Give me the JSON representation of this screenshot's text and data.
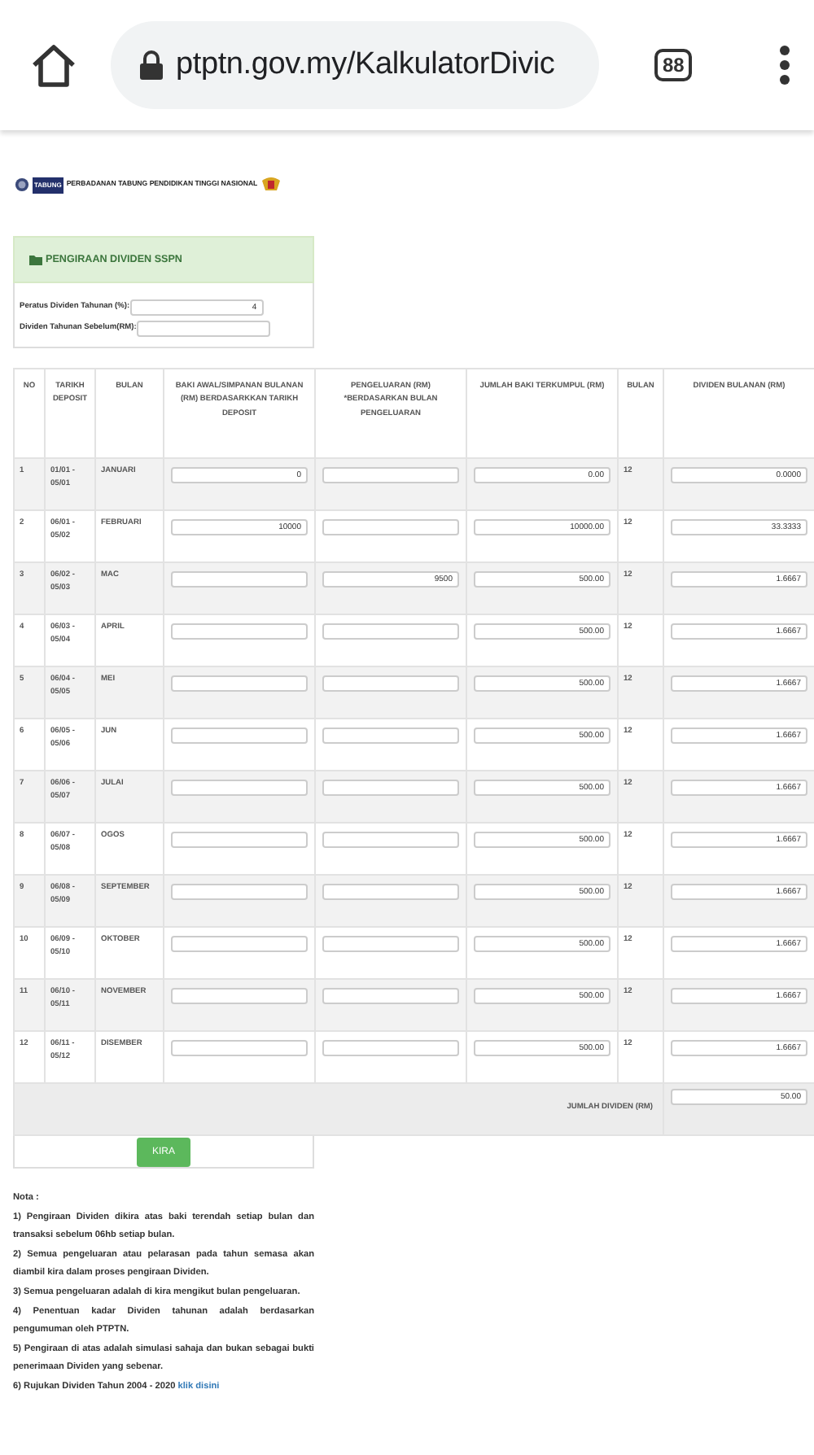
{
  "browser": {
    "url": "ptptn.gov.my/KalkulatorDivic",
    "tab_count": "88"
  },
  "header": {
    "logo_text": "TABUNG",
    "org_name": "PERBADANAN TABUNG PENDIDIKAN TINGGI NASIONAL"
  },
  "panel": {
    "title": "PENGIRAAN DIVIDEN SSPN",
    "fields": [
      {
        "label": "Peratus Dividen Tahunan (%):",
        "value": "4"
      },
      {
        "label": "Dividen Tahunan Sebelum(RM):"
      }
    ]
  },
  "table": {
    "columns": [
      "NO",
      "TARIKH DEPOSIT",
      "BULAN",
      "BAKI AWAL/SIMPANAN BULANAN (RM) BERDASARKKAN TARIKH DEPOSIT",
      "PENGELUARAN (RM) *BERDASARKAN BULAN PENGELUARAN",
      "JUMLAH BAKI TERKUMPUL (RM)",
      "BULAN",
      "DIVIDEN BULANAN (RM)"
    ],
    "rows": [
      {
        "no": "1",
        "tarikh": "01/01 - 05/01",
        "bulan": "JANUARI",
        "baki": "0",
        "jumlah": "0.00",
        "months": "12",
        "dividen": "0.0000"
      },
      {
        "no": "2",
        "tarikh": "06/01 - 05/02",
        "bulan": "FEBRUARI",
        "baki": "10000",
        "jumlah": "10000.00",
        "months": "12",
        "dividen": "33.3333"
      },
      {
        "no": "3",
        "tarikh": "06/02 - 05/03",
        "bulan": "MAC",
        "pengeluaran": "9500",
        "jumlah": "500.00",
        "months": "12",
        "dividen": "1.6667"
      },
      {
        "no": "4",
        "tarikh": "06/03 - 05/04",
        "bulan": "APRIL",
        "jumlah": "500.00",
        "months": "12",
        "dividen": "1.6667"
      },
      {
        "no": "5",
        "tarikh": "06/04 - 05/05",
        "bulan": "MEI",
        "jumlah": "500.00",
        "months": "12",
        "dividen": "1.6667"
      },
      {
        "no": "6",
        "tarikh": "06/05 - 05/06",
        "bulan": "JUN",
        "jumlah": "500.00",
        "months": "12",
        "dividen": "1.6667"
      },
      {
        "no": "7",
        "tarikh": "06/06 - 05/07",
        "bulan": "JULAI",
        "jumlah": "500.00",
        "months": "12",
        "dividen": "1.6667"
      },
      {
        "no": "8",
        "tarikh": "06/07 - 05/08",
        "bulan": "OGOS",
        "jumlah": "500.00",
        "months": "12",
        "dividen": "1.6667"
      },
      {
        "no": "9",
        "tarikh": "06/08 - 05/09",
        "bulan": "SEPTEMBER",
        "jumlah": "500.00",
        "months": "12",
        "dividen": "1.6667"
      },
      {
        "no": "10",
        "tarikh": "06/09 - 05/10",
        "bulan": "OKTOBER",
        "jumlah": "500.00",
        "months": "12",
        "dividen": "1.6667"
      },
      {
        "no": "11",
        "tarikh": "06/10 - 05/11",
        "bulan": "NOVEMBER",
        "jumlah": "500.00",
        "months": "12",
        "dividen": "1.6667"
      },
      {
        "no": "12",
        "tarikh": "06/11 - 05/12",
        "bulan": "DISEMBER",
        "jumlah": "500.00",
        "months": "12",
        "dividen": "1.6667"
      }
    ],
    "total_label": "JUMLAH DIVIDEN (RM)",
    "total_value": "50.00"
  },
  "button": "KIRA",
  "notes": {
    "title": "Nota :",
    "items": [
      "1) Pengiraan Dividen dikira atas baki terendah setiap bulan dan transaksi sebelum 06hb setiap bulan.",
      "2) Semua pengeluaran atau pelarasan pada tahun semasa akan diambil kira dalam proses pengiraan Dividen.",
      "3) Semua pengeluaran adalah di kira mengikut bulan pengeluaran.",
      "4) Penentuan kadar Dividen tahunan adalah berdasarkan pengumuman oleh PTPTN.",
      "5) Pengiraan di atas adalah simulasi sahaja dan bukan sebagai bukti penerimaan Dividen yang sebenar."
    ],
    "last": "6) Rujukan Dividen Tahun 2004 - 2020",
    "link": "klik disini"
  }
}
